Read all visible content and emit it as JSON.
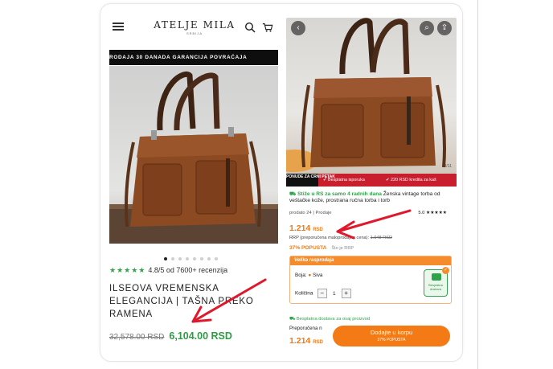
{
  "left": {
    "brand": "ATELJE MILA",
    "brand_sub": "SRBIJA",
    "banner_text": "RODAJA    30 DANADA GARANCIJA POVRAĆAJA",
    "carousel_dots": 8,
    "carousel_active_index": 0,
    "rating_text": "4.8/5 od 7600+ recenzija",
    "title": "ILSEOVA VREMENSKA ELEGANCIJA | TAŠNA PREKO RAMENA",
    "old_price": "32,578.00 RSD",
    "new_price": "6,104.00 RSD"
  },
  "right": {
    "image_counter": "4/11",
    "promo_tag": "PONUDE ZA CRNI PETAK",
    "promo_items": [
      "Besplatna isporuka",
      "220 RSD kredita za kaš"
    ],
    "ship_highlight": "Stiže u RS za samo 4 radnih dana",
    "ship_rest": " Ženska vintage torba od veštačke kože, prostrana ručna torba i torb",
    "sold_left": "prodato 24 | Prodaje",
    "sold_right": "5.0 ★★★★★",
    "price": "1.214",
    "price_currency": "RSD",
    "rrp_label": "RRP (preporučena maloprodajna cena):",
    "rrp_value": "1.948 RSD",
    "discount": "37% POPUSTA",
    "discount_sub": "Što je RRP",
    "sale_header": "Velika rasprodaja",
    "color_label": "Boja:",
    "color_value": "Siva",
    "qty_label": "Količina",
    "qty_minus": "−",
    "qty_value": "1",
    "qty_plus": "+",
    "safe_badge": "Besplatna dostava",
    "free_shipping": "Besplatna dostava za ovaj proizvod",
    "bottom_rrp": "Preporučena n",
    "bottom_price": "1.214",
    "bottom_currency": "RSD",
    "add_to_cart": "Dodajte u korpu",
    "add_to_cart_sub": "37% POPUSTA"
  },
  "colors": {
    "green": "#2f9c45",
    "orange": "#f07b16",
    "red_arrow": "#e0182c",
    "promo_red": "#c81e2e"
  }
}
